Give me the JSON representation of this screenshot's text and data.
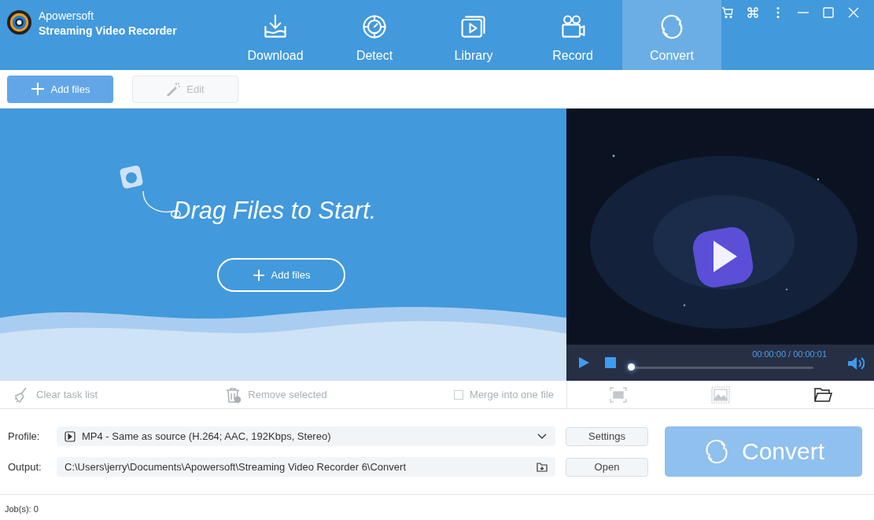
{
  "app": {
    "brand": "Apowersoft",
    "product": "Streaming Video Recorder"
  },
  "nav": [
    {
      "label": "Download",
      "selected": false
    },
    {
      "label": "Detect",
      "selected": false
    },
    {
      "label": "Library",
      "selected": false
    },
    {
      "label": "Record",
      "selected": false
    },
    {
      "label": "Convert",
      "selected": true
    }
  ],
  "toolbar": [
    {
      "label": "Add files",
      "kind": "add",
      "disabled": false
    },
    {
      "label": "Edit",
      "kind": "edit",
      "disabled": true
    }
  ],
  "dropzone": {
    "title": "Drag Files to Start.",
    "button": "Add files"
  },
  "player": {
    "time": "00:00:00 / 00:00:01",
    "level": 0
  },
  "actions": [
    {
      "label": "Clear task list",
      "kind": "clear",
      "disabled": true
    },
    {
      "label": "Remove selected",
      "kind": "remove",
      "disabled": true
    },
    {
      "label": "Merge into one file",
      "kind": "checkbox",
      "disabled": true,
      "checked": false
    }
  ],
  "profile": {
    "label": "Profile:",
    "value": "MP4 - Same as source (H.264; AAC, 192Kbps, Stereo)",
    "button": "Settings"
  },
  "output": {
    "label": "Output:",
    "value": "C:\\Users\\jerry\\Documents\\Apowersoft\\Streaming Video Recorder 6\\Convert",
    "button": "Open"
  },
  "convert": {
    "label": "Convert",
    "disabled": true
  },
  "status_bar": "Job(s): 0"
}
